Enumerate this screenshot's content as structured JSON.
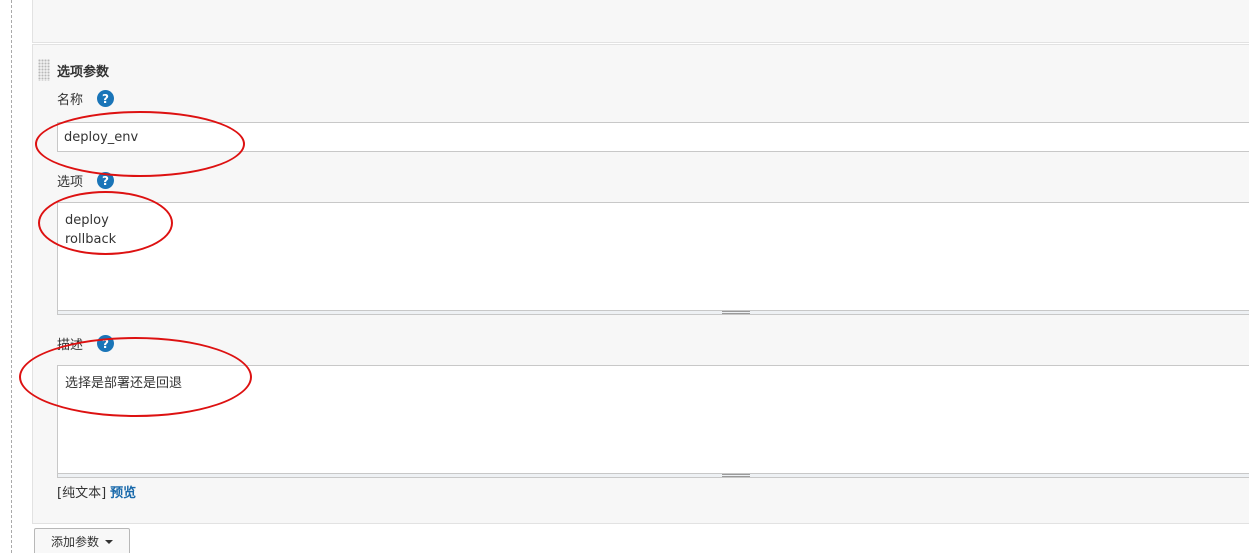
{
  "section": {
    "title": "选项参数"
  },
  "name_field": {
    "label": "名称",
    "value": "deploy_env"
  },
  "choices_field": {
    "label": "选项",
    "value": "deploy\nrollback"
  },
  "description_field": {
    "label": "描述",
    "value": "选择是部署还是回退"
  },
  "format": {
    "plain_text": "[纯文本]",
    "preview": "预览"
  },
  "help_icon_glyph": "?",
  "add_parameter": {
    "label": "添加参数"
  },
  "colors": {
    "accent": "#1a75b8",
    "annotation": "#dd1111",
    "panel_bg": "#f7f7f7"
  }
}
